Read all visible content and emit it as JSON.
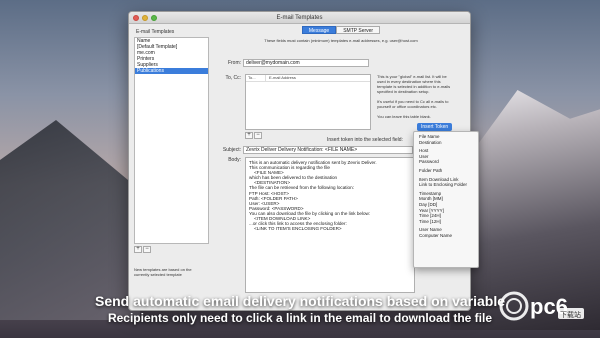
{
  "window": {
    "title": "E-mail Templates"
  },
  "sidebar": {
    "header": "E-mail Templates",
    "items": [
      {
        "label": "Name",
        "selected": false
      },
      {
        "label": "[Default Template]",
        "selected": false
      },
      {
        "label": "me.com",
        "selected": false
      },
      {
        "label": "Printers",
        "selected": false
      },
      {
        "label": "Suppliers",
        "selected": false
      },
      {
        "label": "Publications",
        "selected": true
      }
    ],
    "add_label": "+",
    "remove_label": "−",
    "note": "New templates are based on the currently selected template"
  },
  "tabs": [
    {
      "label": "Message",
      "active": true
    },
    {
      "label": "SMTP Server",
      "active": false
    }
  ],
  "info_text": "These fields must contain (minimum) templates e-mail addresses, e.g. user@host.com",
  "from": {
    "label": "From:",
    "value": "deliver@mydomain.com"
  },
  "to_cc": {
    "label": "To, Cc:",
    "col_to": "To...",
    "col_email": "E-mail Address",
    "add_label": "+",
    "remove_label": "−"
  },
  "right_note": [
    "This is your \"global\" e-mail list. It will be",
    "used in every destination where this",
    "template is selected in addition to e-mails",
    "specified in destination setup.",
    "",
    "It's useful if you need to Cc all e-mails to",
    "yourself or office coordinators etc.",
    "",
    "You can leave this table blank."
  ],
  "insert_token": {
    "label": "Insert token into the selected field:",
    "button": "Insert Token"
  },
  "subject": {
    "label": "Subject:",
    "value": "Zevrix Deliver Delivery Notification: <FILE NAME>"
  },
  "body": {
    "label": "Body:",
    "lines": [
      "This is an automatic delivery notification sent by Zevrix Deliver.",
      "",
      "This communication is regarding the file",
      "    <FILE NAME>",
      "which has been delivered to the destination",
      "    <DESTINATION>",
      "",
      "The file can be retrieved from the following location:",
      "",
      "FTP Host: <HOST>",
      "Path: <FOLDER PATH>",
      "User: <USER>",
      "Password: <PASSWORD>",
      "",
      "You can also download the file by clicking on the link below:",
      "    <ITEM DOWNLOAD LINK>",
      "",
      "...or click this link to access the enclosing folder:",
      "    <LINK TO ITEM'S ENCLOSING FOLDER>"
    ]
  },
  "dropdown": {
    "groups": [
      [
        "File Name",
        "Destination"
      ],
      [
        "Host",
        "User",
        "Password"
      ],
      [
        "Folder Path"
      ],
      [
        "Item Download Link",
        "Link to Enclosing Folder"
      ],
      [
        "Timestamp",
        "Month [MM]",
        "Day [DD]",
        "Year [YYYY]",
        "Time [24H]",
        "Time [12H]"
      ],
      [
        "User Name",
        "Computer Name"
      ]
    ]
  },
  "caption": {
    "line1": "Send automatic email delivery notifications based on variable",
    "line2": "Recipients only need to click a link in the email to download the file"
  },
  "watermark": {
    "text": "pc6",
    "sub": "下载站"
  },
  "colors": {
    "accent": "#3b7ddb",
    "window_bg": "#ececec"
  }
}
